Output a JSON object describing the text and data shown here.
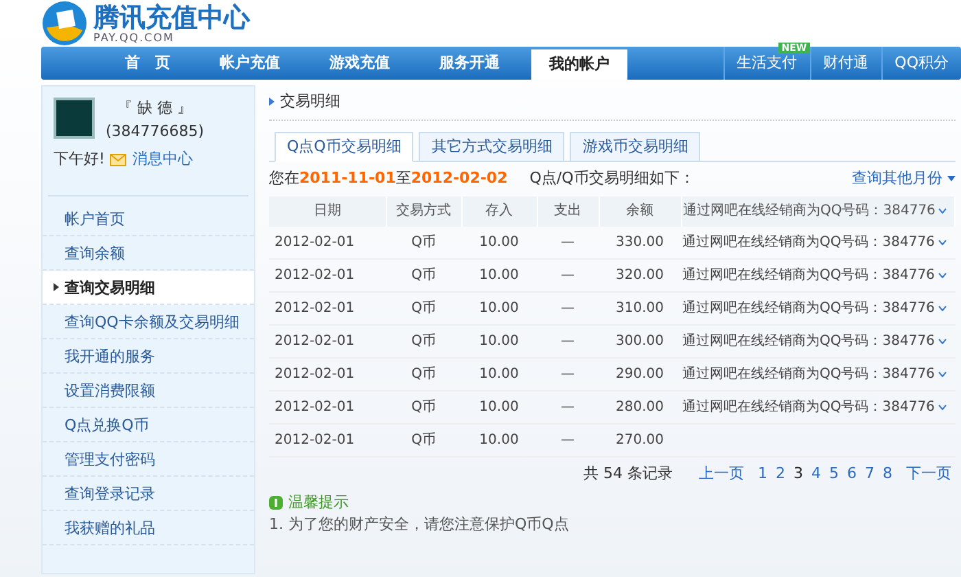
{
  "logo": {
    "title": "腾讯充值中心",
    "subtitle": "PAY.QQ.COM"
  },
  "nav": [
    {
      "label": "首　页",
      "selected": false
    },
    {
      "label": "帐户充值",
      "selected": false
    },
    {
      "label": "游戏充值",
      "selected": false
    },
    {
      "label": "服务开通",
      "selected": false
    },
    {
      "label": "我的帐户",
      "selected": true
    }
  ],
  "nav_right": [
    {
      "label": "生活支付",
      "badge": "NEW"
    },
    {
      "label": "财付通"
    },
    {
      "label": "QQ积分"
    }
  ],
  "profile": {
    "nickname": "『 缺 德 』",
    "qq": "(384776685)",
    "greeting": "下午好!",
    "message_link": "消息中心"
  },
  "sidebar": {
    "items": [
      {
        "label": "帐户首页",
        "selected": false
      },
      {
        "label": "查询余额",
        "selected": false
      },
      {
        "label": "查询交易明细",
        "selected": true
      },
      {
        "label": "查询QQ卡余额及交易明细",
        "selected": false
      },
      {
        "label": "我开通的服务",
        "selected": false
      },
      {
        "label": "设置消费限额",
        "selected": false
      },
      {
        "label": "Q点兑换Q币",
        "selected": false
      },
      {
        "label": "管理支付密码",
        "selected": false
      },
      {
        "label": "查询登录记录",
        "selected": false
      },
      {
        "label": "我获赠的礼品",
        "selected": false
      }
    ]
  },
  "section_title": "交易明细",
  "tabs": [
    {
      "label": "Q点Q币交易明细",
      "selected": true
    },
    {
      "label": "其它方式交易明细",
      "selected": false
    },
    {
      "label": "游戏币交易明细",
      "selected": false
    }
  ],
  "range": {
    "prefix": "您在",
    "from": "2011-11-01",
    "middle": "至",
    "to": "2012-02-02",
    "suffix": "Q点/Q币交易明细如下：",
    "other_months": "查询其他月份"
  },
  "table": {
    "columns": [
      "日期",
      "交易方式",
      "存入",
      "支出",
      "余额"
    ],
    "header_note": "通过网吧在线经销商为QQ号码：384776",
    "rows": [
      {
        "date": "2012-02-01",
        "method": "Q币",
        "deposit": "10.00",
        "withdraw": "—",
        "balance": "330.00",
        "note": "通过网吧在线经销商为QQ号码：384776"
      },
      {
        "date": "2012-02-01",
        "method": "Q币",
        "deposit": "10.00",
        "withdraw": "—",
        "balance": "320.00",
        "note": "通过网吧在线经销商为QQ号码：384776"
      },
      {
        "date": "2012-02-01",
        "method": "Q币",
        "deposit": "10.00",
        "withdraw": "—",
        "balance": "310.00",
        "note": "通过网吧在线经销商为QQ号码：384776"
      },
      {
        "date": "2012-02-01",
        "method": "Q币",
        "deposit": "10.00",
        "withdraw": "—",
        "balance": "300.00",
        "note": "通过网吧在线经销商为QQ号码：384776"
      },
      {
        "date": "2012-02-01",
        "method": "Q币",
        "deposit": "10.00",
        "withdraw": "—",
        "balance": "290.00",
        "note": "通过网吧在线经销商为QQ号码：384776"
      },
      {
        "date": "2012-02-01",
        "method": "Q币",
        "deposit": "10.00",
        "withdraw": "—",
        "balance": "280.00",
        "note": "通过网吧在线经销商为QQ号码：384776"
      },
      {
        "date": "2012-02-01",
        "method": "Q币",
        "deposit": "10.00",
        "withdraw": "—",
        "balance": "270.00"
      }
    ]
  },
  "pagination": {
    "total": "共 54 条记录",
    "prev": "上一页",
    "pages": [
      {
        "label": "1",
        "selected": false
      },
      {
        "label": "2",
        "selected": false
      },
      {
        "label": "3",
        "selected": true
      },
      {
        "label": "4",
        "selected": false
      },
      {
        "label": "5",
        "selected": false
      },
      {
        "label": "6",
        "selected": false
      },
      {
        "label": "7",
        "selected": false
      },
      {
        "label": "8",
        "selected": false
      }
    ],
    "next": "下一页"
  },
  "tips": {
    "title": "温馨提示",
    "lines": [
      "1. 为了您的财产安全，请您注意保护Q币Q点"
    ]
  }
}
